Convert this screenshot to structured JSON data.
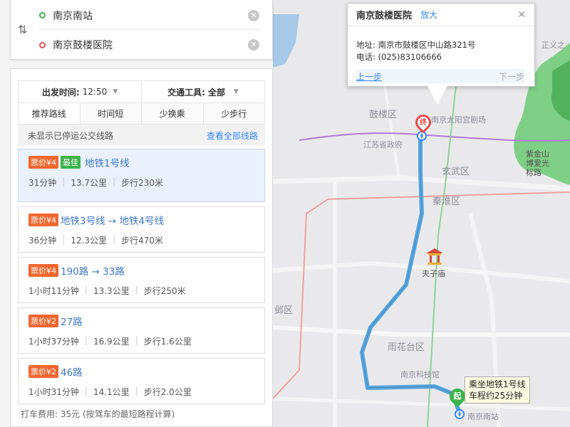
{
  "route": {
    "start": "南京南站",
    "end": "南京鼓楼医院"
  },
  "filters": {
    "depart_label": "出发时间:",
    "depart_value": "12:50",
    "tool_label": "交通工具:",
    "tool_value": "全部",
    "tabs": [
      "推荐路线",
      "时间短",
      "少换乘",
      "少步行"
    ]
  },
  "notice": {
    "text": "未显示已停运公交线路",
    "link": "查看全部线路"
  },
  "plans": [
    {
      "price": "票价¥4",
      "best": "最佳",
      "lines": "地铁1号线",
      "duration": "31分钟",
      "distance": "13.7公里",
      "walk": "步行230米"
    },
    {
      "price": "票价¥4",
      "lines": "地铁3号线 → 地铁4号线",
      "duration": "36分钟",
      "distance": "12.3公里",
      "walk": "步行470米"
    },
    {
      "price": "票价¥4",
      "lines": "190路 → 33路",
      "duration": "1小时11分钟",
      "distance": "13.3公里",
      "walk": "步行250米"
    },
    {
      "price": "票价¥2",
      "lines": "27路",
      "duration": "1小时37分钟",
      "distance": "16.9公里",
      "walk": "步行1.6公里"
    },
    {
      "price": "票价¥2",
      "lines": "46路",
      "duration": "1小时31分钟",
      "distance": "14.1公里",
      "walk": "步行2.0公里"
    }
  ],
  "taxi": "打车费用: 35元 (按驾车的最短路程计算)",
  "popup": {
    "title": "南京鼓楼医院",
    "zoom": "放大",
    "address": "地址: 南京市鼓楼区中山路321号",
    "phone": "电话: (025)83106666",
    "prev": "上一步",
    "next": "下一步"
  },
  "markers": {
    "end": "终",
    "start": "起",
    "tooltip_line1": "乘坐地铁1号线",
    "tooltip_line2": "车程约25分钟"
  },
  "map_labels": {
    "gulou": "鼓楼区",
    "jiangsu_gov": "江苏省政府",
    "taiyang": "南京太阳宫剧场",
    "xuanwu": "玄武区",
    "qinhuai": "秦淮区",
    "fuzimiao": "夫子庙",
    "yuhuatai": "雨花台区",
    "tech_museum": "南京科技馆",
    "nanjing_south": "南京南站",
    "zijinshan": "紫金山博爱光标路",
    "jianye": "邺区",
    "zhongshan": "正义之"
  },
  "colors": {
    "accent": "#3385ff",
    "route": "#5aa7dd",
    "price": "#f2662e",
    "best": "#3cb44b"
  }
}
